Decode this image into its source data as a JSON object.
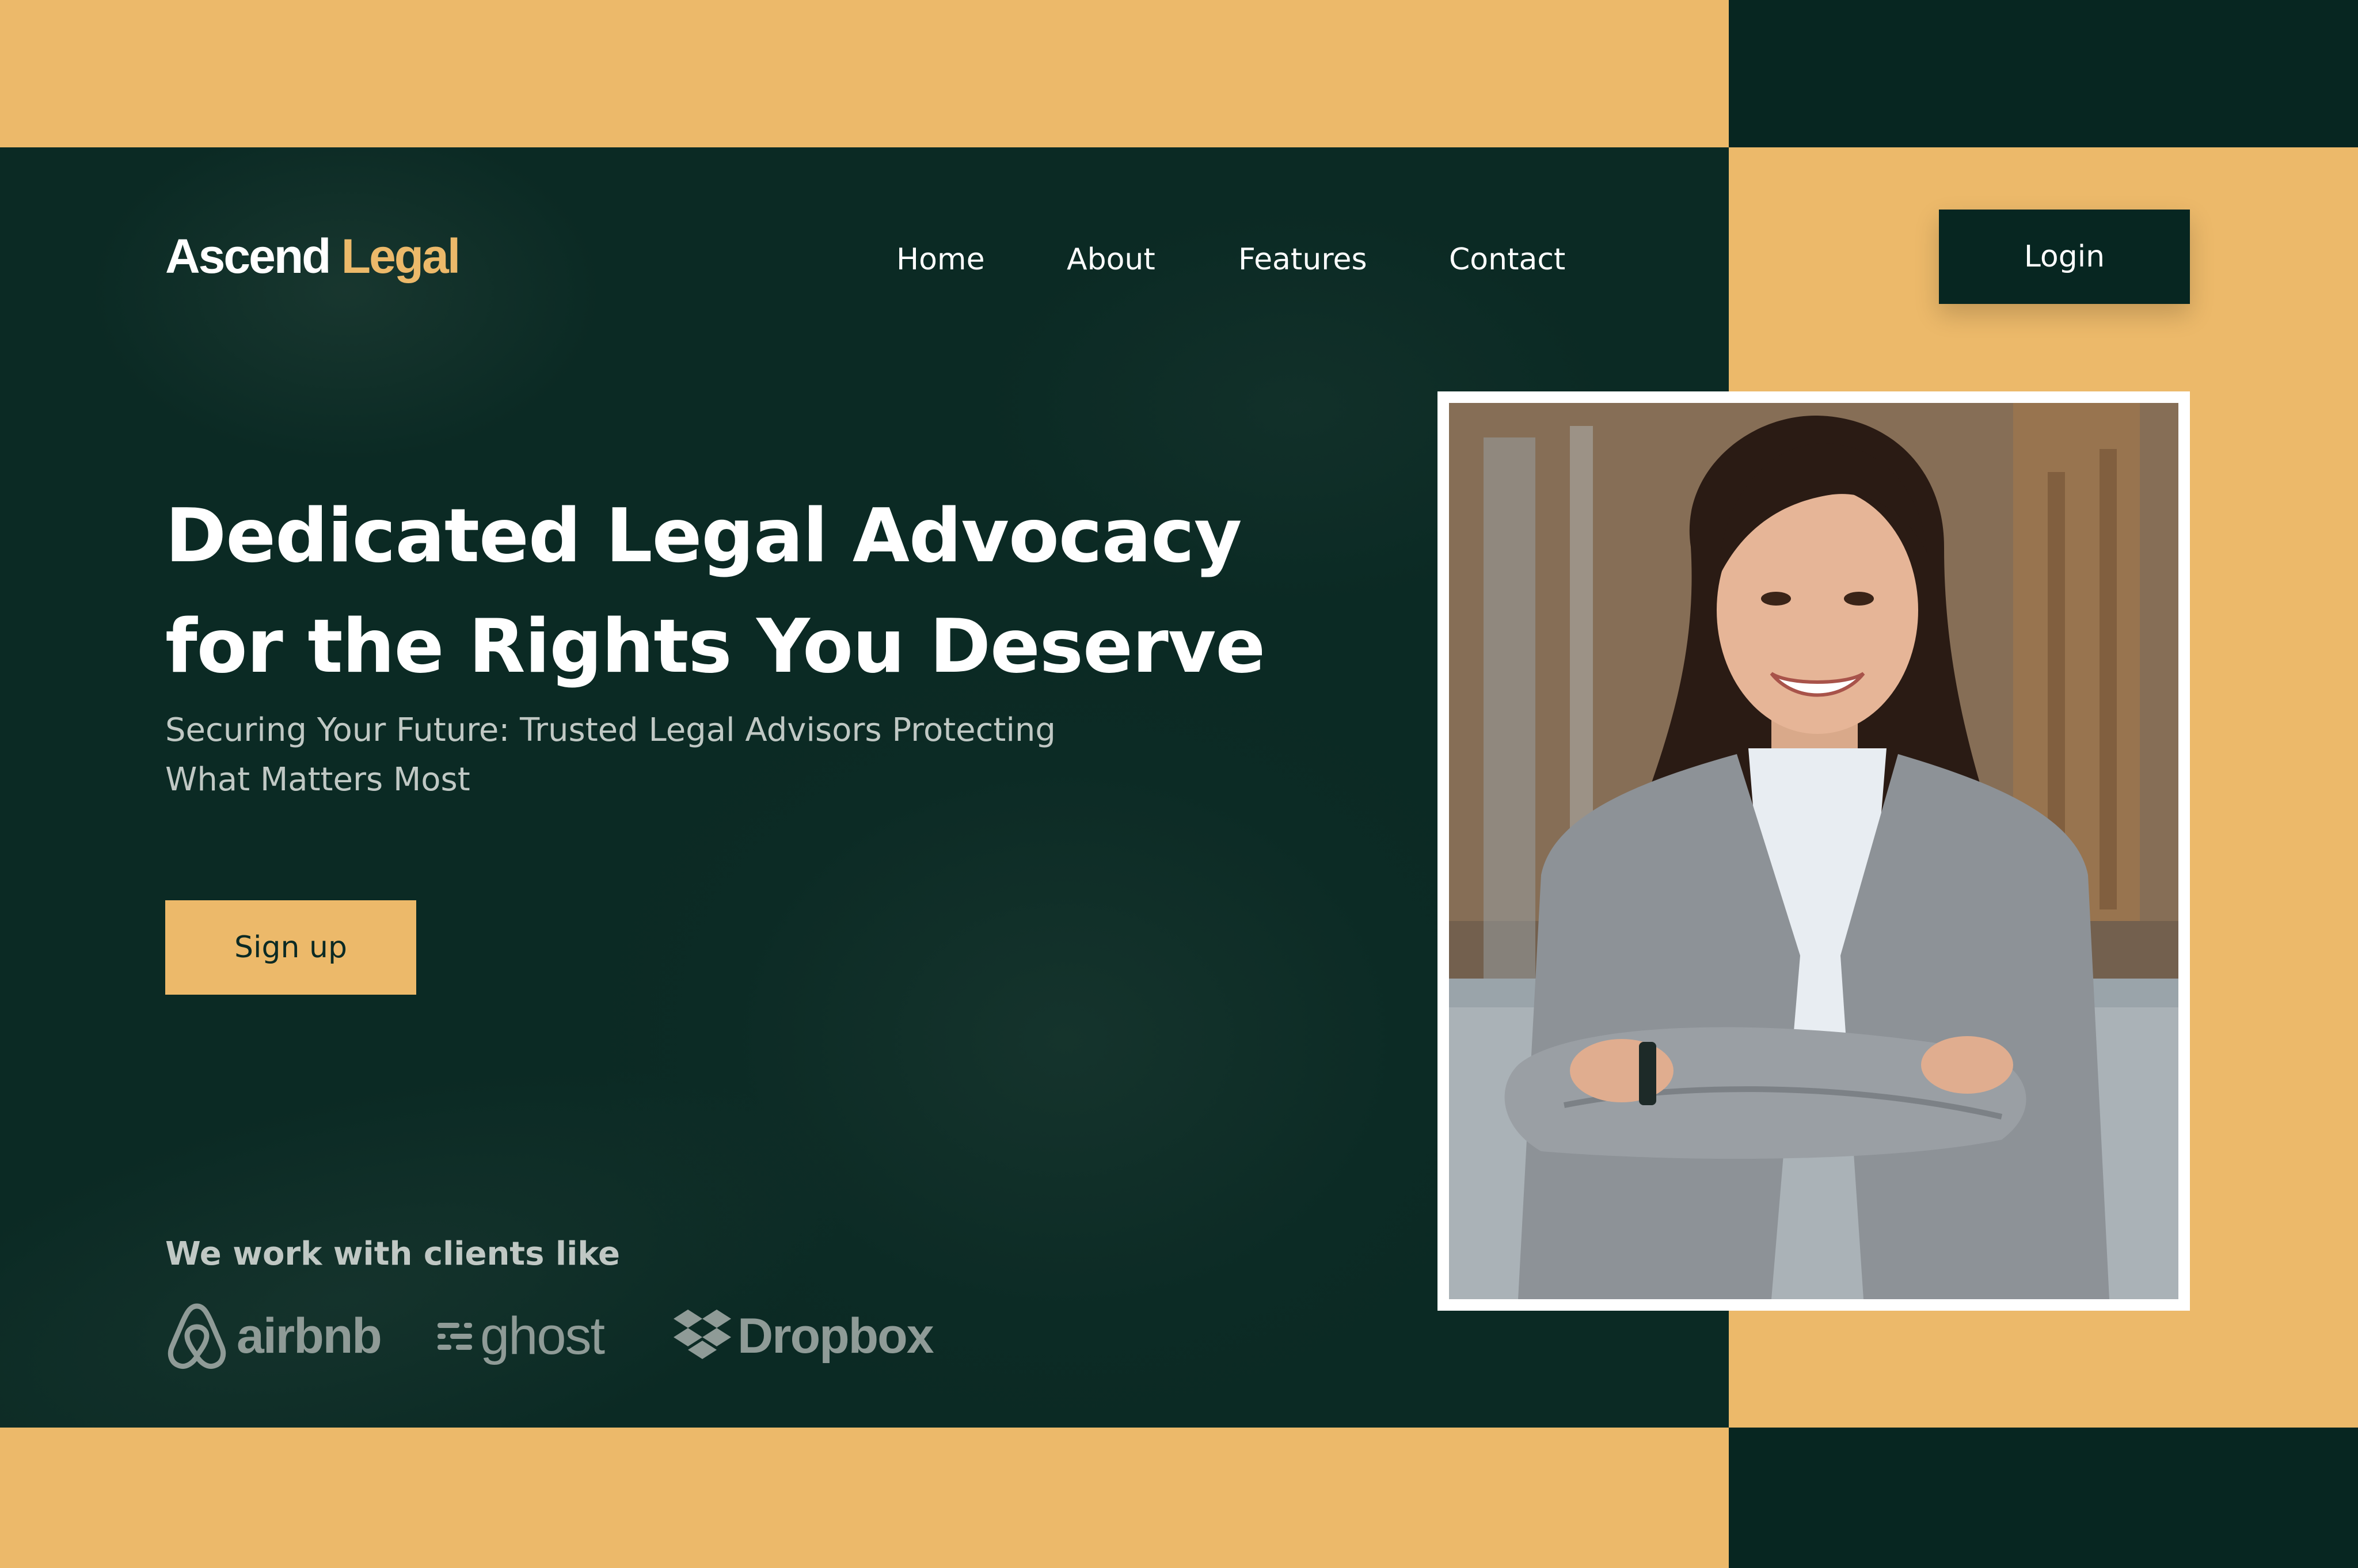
{
  "brand": {
    "name_part1": "Ascend",
    "name_part2": "Legal"
  },
  "nav": {
    "items": [
      "Home",
      "About",
      "Features",
      "Contact"
    ]
  },
  "login": {
    "label": "Login"
  },
  "hero": {
    "headline_line1": "Dedicated Legal Advocacy",
    "headline_line2": "for the Rights You Deserve",
    "subtitle_line1": "Securing Your Future: Trusted Legal Advisors Protecting",
    "subtitle_line2": "What Matters Most",
    "signup_label": "Sign up"
  },
  "clients": {
    "label": "We work with clients like",
    "logos": [
      {
        "icon": "airbnb-icon",
        "name": "airbnb"
      },
      {
        "icon": "ghost-icon",
        "name": "ghost"
      },
      {
        "icon": "dropbox-icon",
        "name": "Dropbox"
      }
    ]
  },
  "colors": {
    "accent": "#ecb96a",
    "dark": "#072621",
    "hero_bg": "#0b2a24",
    "text": "#ffffff",
    "muted": "#c0c8c4"
  }
}
